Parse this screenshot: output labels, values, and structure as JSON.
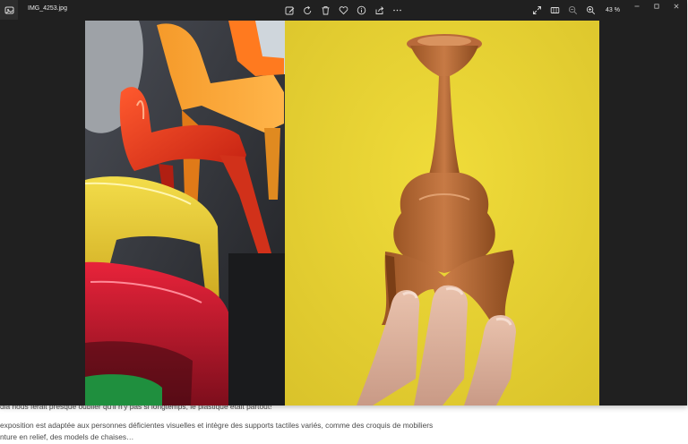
{
  "viewer": {
    "file_name": "IMG_4253.jpg",
    "zoom": "43 %",
    "toolbar_icons": [
      "edit-icon",
      "rotate-icon",
      "delete-icon",
      "favorite-icon",
      "info-icon",
      "share-icon",
      "more-icon"
    ],
    "right_icons": [
      "fullscreen-icon",
      "filmstrip-icon",
      "zoom-out-icon",
      "zoom-in-icon"
    ],
    "window_controls": [
      "minimize-icon",
      "maximize-icon",
      "close-icon"
    ],
    "colors": {
      "background": "#202020",
      "photo_right_background": "#e4d135"
    }
  },
  "page_behind": {
    "line1": "dia nous ferait presque oublier qu'il n'y pas si longtemps, le plastique était partout!",
    "line2": "exposition est adaptée aux personnes déficientes visuelles et intègre des supports tactiles variés, comme des croquis de mobiliers",
    "line3": "nture en relief, des models de chaises…"
  }
}
